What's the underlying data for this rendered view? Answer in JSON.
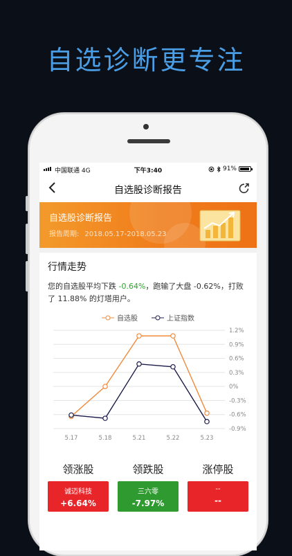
{
  "headline": "自选诊断更专注",
  "status_bar": {
    "carrier": "中国联通",
    "network": "4G",
    "time": "下午3:40",
    "battery": "91%"
  },
  "nav": {
    "title": "自选股诊断报告"
  },
  "banner": {
    "title": "自选股诊断报告",
    "period_label": "报告周期:",
    "period_value": "2018.05.17-2018.05.23"
  },
  "trend": {
    "section_title": "行情走势",
    "summary_part1": "您的自选股平均下跌 ",
    "summary_value": "-0.64%",
    "summary_part2": "，跑输了大盘 -0.62%，打败了 11.88% 的灯塔用户。"
  },
  "chart_data": {
    "type": "line",
    "categories": [
      "5.17",
      "5.18",
      "5.21",
      "5.22",
      "5.23"
    ],
    "series": [
      {
        "name": "自选股",
        "color": "#f08a3c",
        "values": [
          -0.64,
          0.0,
          1.08,
          1.08,
          -0.57
        ]
      },
      {
        "name": "上证指数",
        "color": "#1a1a4a",
        "values": [
          -0.61,
          -0.68,
          0.48,
          0.42,
          -0.75
        ]
      }
    ],
    "y_ticks": [
      "1.2%",
      "0.9%",
      "0.6%",
      "0.3%",
      "0%",
      "-0.3%",
      "-0.6%",
      "-0.9%"
    ],
    "ylim": [
      -0.9,
      1.2
    ],
    "axis_side": "right",
    "grid": true,
    "legend_position": "top-center"
  },
  "stocks": {
    "rising": {
      "header": "领涨股",
      "name": "诚迈科技",
      "value": "+6.64%"
    },
    "falling": {
      "header": "领跌股",
      "name": "三六零",
      "value": "-7.97%"
    },
    "limit_up": {
      "header": "涨停股",
      "name": "--",
      "value": "--"
    }
  }
}
